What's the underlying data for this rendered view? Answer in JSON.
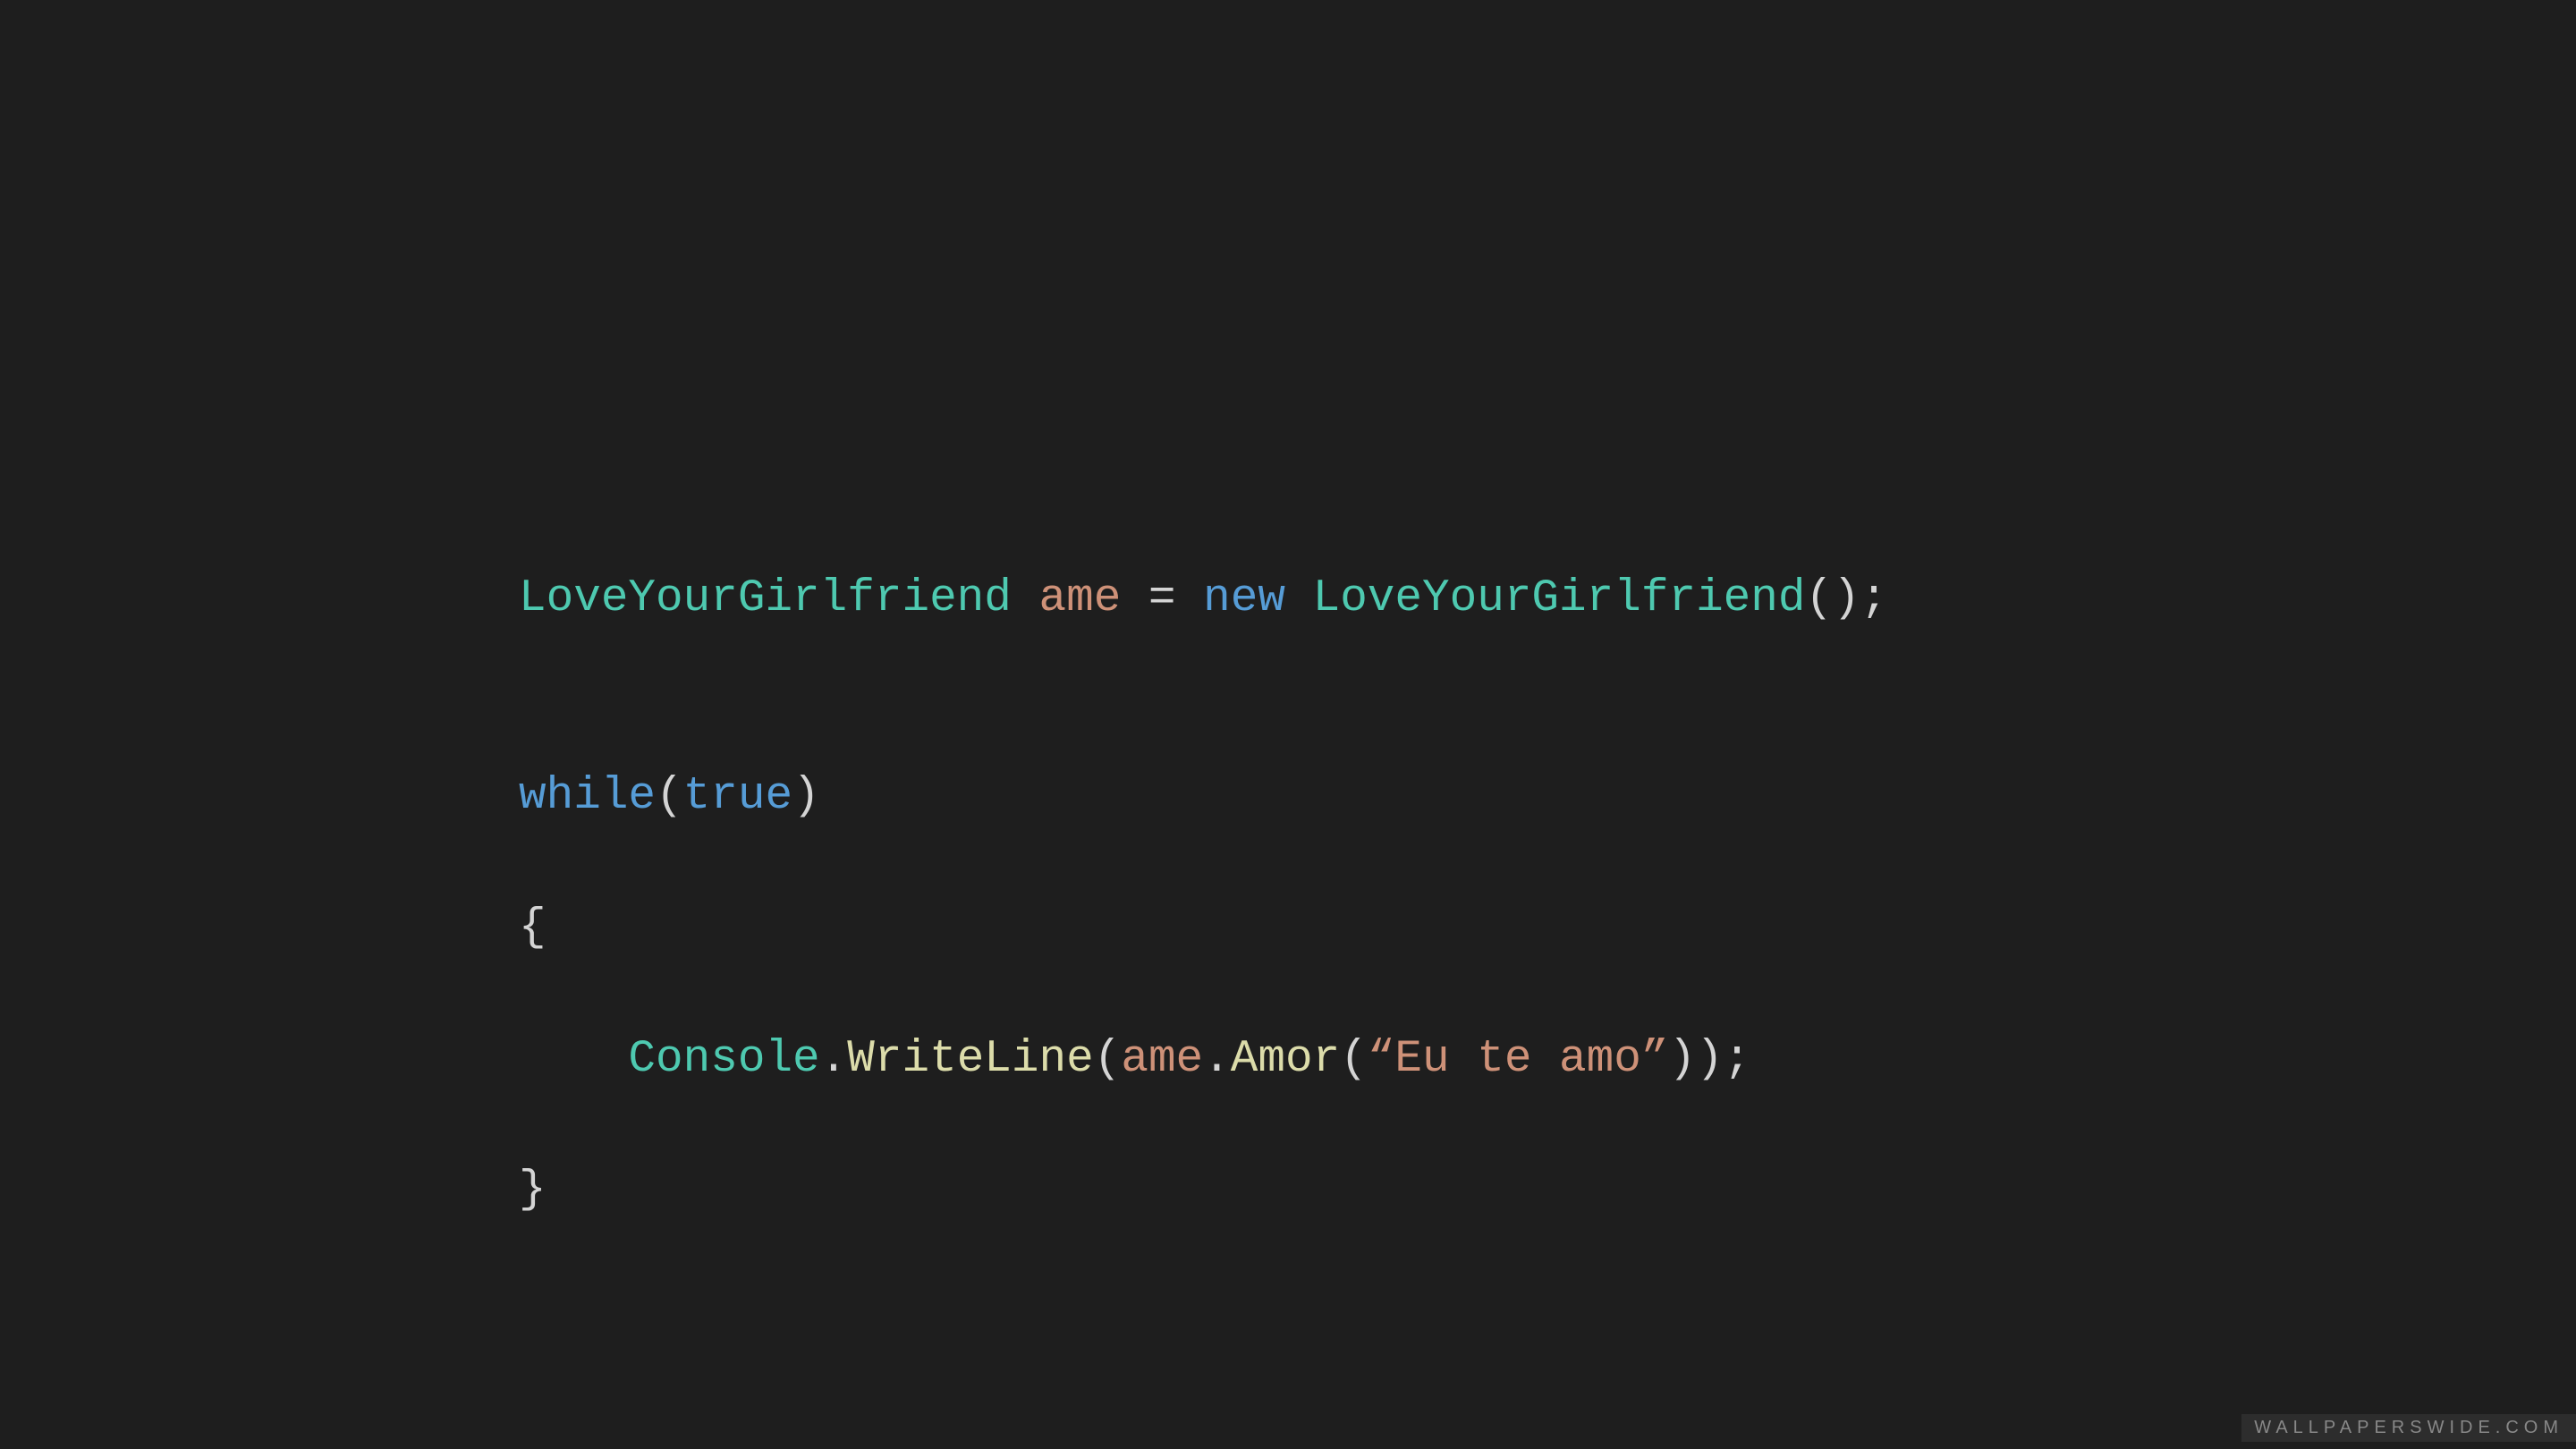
{
  "code": {
    "line1": {
      "class1": "LoveYourGirlfriend",
      "space1": " ",
      "var": "ame",
      "assign": " = ",
      "newkw": "new",
      "space2": " ",
      "class2": "LoveYourGirlfriend",
      "parens": "()",
      "semi": ";"
    },
    "line2": "",
    "line3": {
      "while": "while",
      "open": "(",
      "true": "true",
      "close": ")"
    },
    "line4": "{",
    "line5": {
      "indent": "    ",
      "console": "Console",
      "dot1": ".",
      "writeline": "WriteLine",
      "open1": "(",
      "ame": "ame",
      "dot2": ".",
      "amor": "Amor",
      "open2": "(",
      "openquote": "“",
      "string": "Eu te amo",
      "closequote": "”",
      "close2": ")",
      "close1": ")",
      "semi": ";"
    },
    "line6": "}"
  },
  "watermark": "WALLPAPERSWIDE.COM"
}
